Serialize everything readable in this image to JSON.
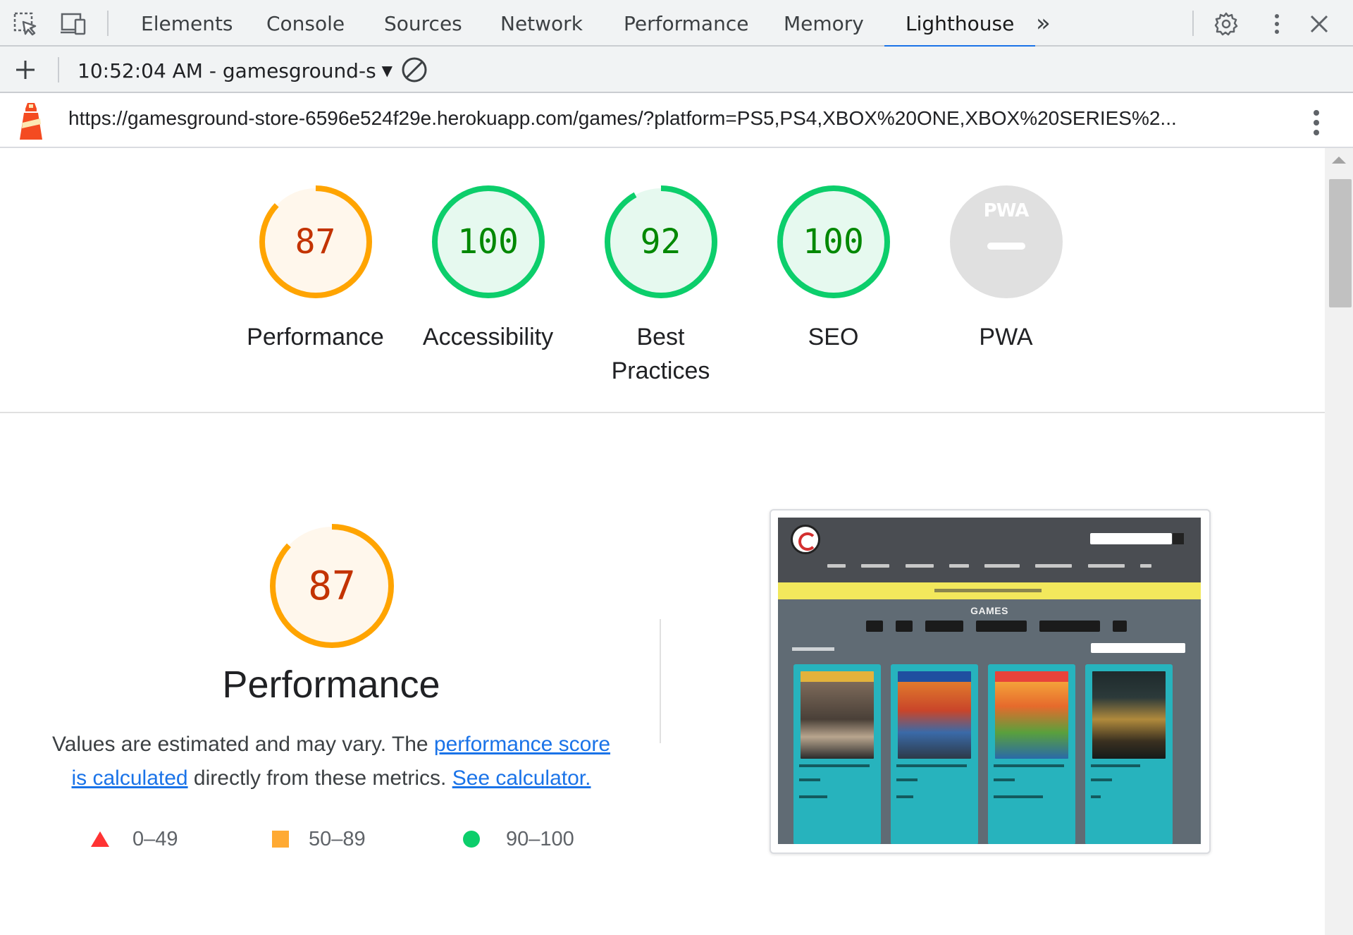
{
  "devtools": {
    "tabs": [
      {
        "label": "Elements"
      },
      {
        "label": "Console"
      },
      {
        "label": "Sources"
      },
      {
        "label": "Network"
      },
      {
        "label": "Performance"
      },
      {
        "label": "Memory"
      },
      {
        "label": "Lighthouse",
        "active": true
      }
    ],
    "overflow_glyph": "»"
  },
  "toolbar": {
    "report_label": "10:52:04 AM - gamesground-s"
  },
  "url_bar": {
    "url": "https://gamesground-store-6596e524f29e.herokuapp.com/games/?platform=PS5,PS4,XBOX%20ONE,XBOX%20SERIES%2..."
  },
  "categories": [
    {
      "score": "87",
      "label": "Performance",
      "fraction": 0.87,
      "status": "average"
    },
    {
      "score": "100",
      "label": "Accessibility",
      "fraction": 1.0,
      "status": "pass"
    },
    {
      "score": "92",
      "label_line1": "Best",
      "label_line2": "Practices",
      "fraction": 0.92,
      "status": "pass"
    },
    {
      "score": "100",
      "label": "SEO",
      "fraction": 1.0,
      "status": "pass"
    },
    {
      "score": "",
      "badge": "PWA",
      "label": "PWA",
      "status": "na"
    }
  ],
  "performance": {
    "score": "87",
    "fraction": 0.87,
    "title": "Performance",
    "desc_part1": "Values are estimated and may vary. The ",
    "link_score": "performance score is calculated",
    "desc_part2": " directly from these metrics. ",
    "link_calc": "See calculator."
  },
  "legend": [
    {
      "range": "0–49",
      "shape": "triangle",
      "color": "#ff3333"
    },
    {
      "range": "50–89",
      "shape": "square",
      "color": "#ffaa33"
    },
    {
      "range": "90–100",
      "shape": "circle",
      "color": "#0cce6b"
    }
  ],
  "colors": {
    "average_stroke": "#ffa400",
    "average_fill": "#fff7ec",
    "average_text": "#c33300",
    "pass_stroke": "#0cce6b",
    "pass_fill": "#e6f9ef",
    "pass_text": "#008800",
    "na_fill": "#e0e0e0",
    "accent": "#1a73e8"
  },
  "screenshot": {
    "site_heading": "GAMES"
  }
}
